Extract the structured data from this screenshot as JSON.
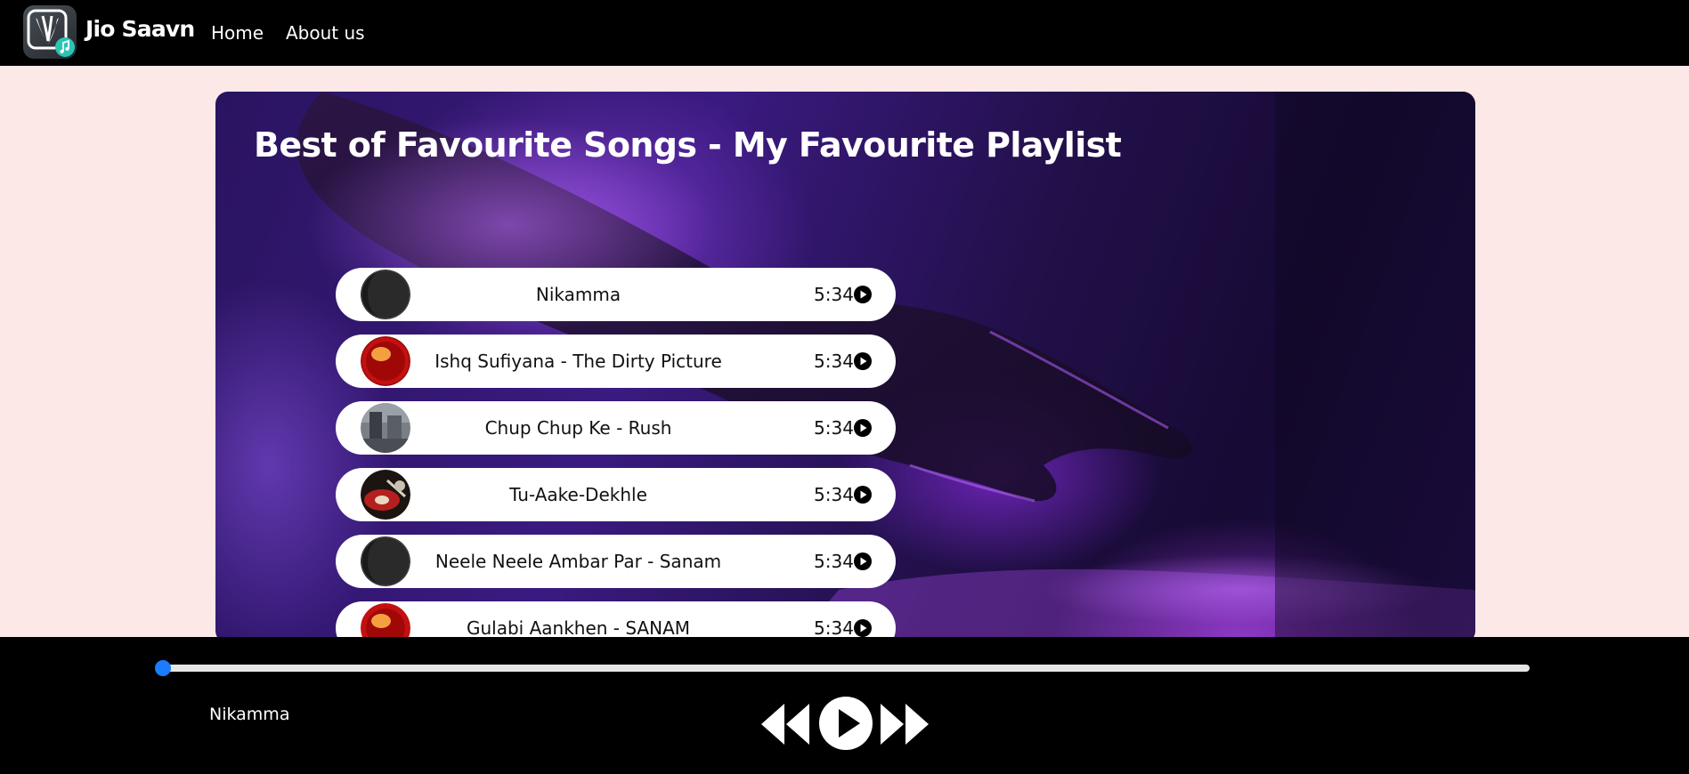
{
  "navbar": {
    "brand": "Jio Saavn",
    "logo_icon": "jiosaavn-logo-icon",
    "links": [
      {
        "label": "Home"
      },
      {
        "label": "About us"
      }
    ]
  },
  "hero": {
    "title": "Best of Favourite Songs - My Favourite Playlist"
  },
  "songs": [
    {
      "name": "Nikamma",
      "duration": "5:34",
      "cover": "dark-disc"
    },
    {
      "name": "Ishq Sufiyana - The Dirty Picture",
      "duration": "5:34",
      "cover": "red-vinyl"
    },
    {
      "name": "Chup Chup Ke - Rush",
      "duration": "5:34",
      "cover": "photo"
    },
    {
      "name": "Tu-Aake-Dekhle",
      "duration": "5:34",
      "cover": "turntable"
    },
    {
      "name": "Neele Neele Ambar Par - Sanam",
      "duration": "5:34",
      "cover": "dark-disc"
    },
    {
      "name": "Gulabi Aankhen - SANAM",
      "duration": "5:34",
      "cover": "red-vinyl"
    }
  ],
  "player": {
    "now_playing": "Nikamma",
    "progress": 0,
    "controls": [
      "previous-icon",
      "play-icon",
      "next-icon"
    ]
  },
  "colors": {
    "navbar_bg": "#000000",
    "page_bg": "#fde8e8",
    "progress_thumb": "#1a7cff",
    "song_pill_bg": "#ffffff"
  }
}
